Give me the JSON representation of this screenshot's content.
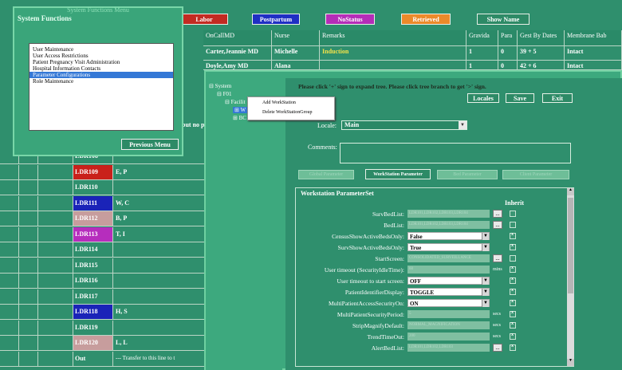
{
  "status_buttons": [
    {
      "label": "Labor",
      "color": "#c22b22"
    },
    {
      "label": "Postpartum",
      "color": "#1f2fc4"
    },
    {
      "label": "NoStatus",
      "color": "#b52db8"
    },
    {
      "label": "Retrieved",
      "color": "#ec8a2a"
    },
    {
      "label": "Show Name",
      "color": "#2d8a66"
    }
  ],
  "grid": {
    "headers": [
      "OnCallMD",
      "Nurse",
      "Remarks",
      "Gravida",
      "Para",
      "Gest By Dates",
      "Membrane Bab"
    ],
    "rows": [
      [
        "Carter,Jeannie MD",
        "Michelle",
        "Induction",
        "1",
        "0",
        "39 + 5",
        "Intact"
      ],
      [
        "Doyle,Amy MD",
        "Alana",
        "",
        "1",
        "0",
        "42 + 6",
        "Intact"
      ]
    ]
  },
  "ldr_rows": [
    {
      "room": "LDR108",
      "color": "",
      "note": ""
    },
    {
      "room": "LDR109",
      "color": "#c9211b",
      "note": "E, P"
    },
    {
      "room": "LDR110",
      "color": "",
      "note": ""
    },
    {
      "room": "LDR111",
      "color": "#1a23b8",
      "note": "W, C"
    },
    {
      "room": "LDR112",
      "color": "#c79d9d",
      "note": "B, P"
    },
    {
      "room": "LDR113",
      "color": "#b62dbd",
      "note": "T, I"
    },
    {
      "room": "LDR114",
      "color": "",
      "note": ""
    },
    {
      "room": "LDR115",
      "color": "",
      "note": ""
    },
    {
      "room": "LDR116",
      "color": "",
      "note": ""
    },
    {
      "room": "LDR117",
      "color": "",
      "note": ""
    },
    {
      "room": "LDR118",
      "color": "#1a23b8",
      "note": "H, S"
    },
    {
      "room": "LDR119",
      "color": "",
      "note": ""
    },
    {
      "room": "LDR120",
      "color": "#c79d9d",
      "note": "L, L"
    },
    {
      "room": "Out",
      "color": "",
      "note": "--- Transfer to this line to t"
    }
  ],
  "partial_note": "but no p",
  "system_functions": {
    "window_title": "System Functions Menu",
    "title": "System Functions",
    "items": [
      "User Maintenance",
      "User Access Restrictions",
      "Patient Pregnancy Visit Administration",
      "Hospital Information Contacts",
      "Parameter Configurations",
      "Role Maintenance"
    ],
    "selected_index": 4,
    "previous_label": "Previous Menu"
  },
  "tree": {
    "root": "System",
    "n1": "F01",
    "n2": "Facilit",
    "n3": "W",
    "n4": "BC"
  },
  "context_menu": [
    "Add WorkStation",
    "Delete WorkStationGroup"
  ],
  "config": {
    "instruction": "Please click '+' sign to expand tree. Please click tree branch to get '>' sign.",
    "locales_label": "Locales",
    "save_label": "Save",
    "exit_label": "Exit",
    "locale_label": "Locale:",
    "locale_value": "Main",
    "comments_label": "Comments:",
    "tabs": [
      "Global Parameter",
      "WorkStation Parameter",
      "Bed Parameter",
      "Client Parameter"
    ],
    "set_title": "Workstation ParameterSet",
    "inherit_label": "Inherit",
    "params": [
      {
        "label": "SurvBedList:",
        "type": "field",
        "value": "LDR101,LDR102,LDR103,LDR104",
        "dots": true
      },
      {
        "label": "BedList:",
        "type": "field",
        "value": "LDR101,LDR102,LDR103,LDR104",
        "dots": true
      },
      {
        "label": "CensusShowActiveBedsOnly:",
        "type": "select",
        "value": "False"
      },
      {
        "label": "SurvShowActiveBedsOnly:",
        "type": "select",
        "value": "True"
      },
      {
        "label": "StartScreen:",
        "type": "field",
        "value": "CONSOLIDATED_SURVEILLANCE",
        "dots": true
      },
      {
        "label": "User timeout (SecurityIdleTime):",
        "type": "field",
        "value": "60",
        "unit": "mins"
      },
      {
        "label": "User timeout to start screen:",
        "type": "select",
        "value": "OFF"
      },
      {
        "label": "PatientIdentifierDisplay:",
        "type": "select",
        "value": "TOGGLE"
      },
      {
        "label": "MultiPatientAccessSecurityOn:",
        "type": "select",
        "value": "ON"
      },
      {
        "label": "MultiPatientSecurityPeriod:",
        "type": "field",
        "value": "5",
        "unit": "secs"
      },
      {
        "label": "StripMagnifyDefault:",
        "type": "field",
        "value": "NORMAL_MAGNIFICATION",
        "unit": "secs"
      },
      {
        "label": "TrendTimeOut:",
        "type": "field",
        "value": "200",
        "unit": "secs"
      },
      {
        "label": "AlertBedList:",
        "type": "field",
        "value": "LDR101,LDR102,LDR103",
        "dots": true
      }
    ]
  }
}
